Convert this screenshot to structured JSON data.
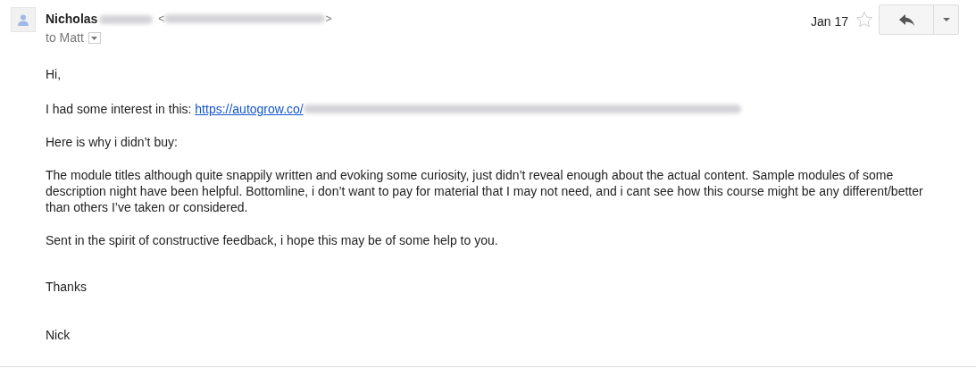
{
  "sender": {
    "name": "Nicholas",
    "email_open": "<",
    "email_close": ">"
  },
  "recipient": "to Matt",
  "date": "Jan 17",
  "starred": false,
  "body": {
    "greeting": "Hi,",
    "link_intro": "I had some interest in this: ",
    "link": "https://autogrow.co/",
    "paragraphs": [
      "Here is why i didn’t buy:",
      "The module titles although quite snappily written and evoking some curiosity, just didn’t reveal enough about the actual content. Sample modules of some description night have been helpful. Bottomline, i don’t want to pay for material that I may not need, and i cant see how this course might be any different/better than others I’ve taken or considered.",
      "Sent in the spirit of constructive feedback, i hope this may be of some help to you."
    ],
    "closing": "Thanks",
    "signature": "Nick"
  }
}
